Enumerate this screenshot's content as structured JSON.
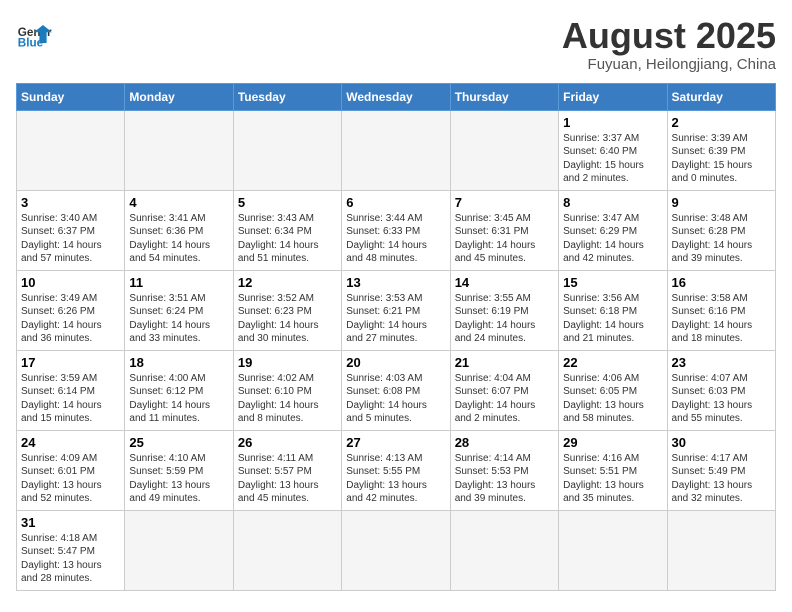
{
  "header": {
    "logo_general": "General",
    "logo_blue": "Blue",
    "title": "August 2025",
    "subtitle": "Fuyuan, Heilongjiang, China"
  },
  "days_of_week": [
    "Sunday",
    "Monday",
    "Tuesday",
    "Wednesday",
    "Thursday",
    "Friday",
    "Saturday"
  ],
  "weeks": [
    [
      {
        "day": "",
        "info": ""
      },
      {
        "day": "",
        "info": ""
      },
      {
        "day": "",
        "info": ""
      },
      {
        "day": "",
        "info": ""
      },
      {
        "day": "",
        "info": ""
      },
      {
        "day": "1",
        "info": "Sunrise: 3:37 AM\nSunset: 6:40 PM\nDaylight: 15 hours and 2 minutes."
      },
      {
        "day": "2",
        "info": "Sunrise: 3:39 AM\nSunset: 6:39 PM\nDaylight: 15 hours and 0 minutes."
      }
    ],
    [
      {
        "day": "3",
        "info": "Sunrise: 3:40 AM\nSunset: 6:37 PM\nDaylight: 14 hours and 57 minutes."
      },
      {
        "day": "4",
        "info": "Sunrise: 3:41 AM\nSunset: 6:36 PM\nDaylight: 14 hours and 54 minutes."
      },
      {
        "day": "5",
        "info": "Sunrise: 3:43 AM\nSunset: 6:34 PM\nDaylight: 14 hours and 51 minutes."
      },
      {
        "day": "6",
        "info": "Sunrise: 3:44 AM\nSunset: 6:33 PM\nDaylight: 14 hours and 48 minutes."
      },
      {
        "day": "7",
        "info": "Sunrise: 3:45 AM\nSunset: 6:31 PM\nDaylight: 14 hours and 45 minutes."
      },
      {
        "day": "8",
        "info": "Sunrise: 3:47 AM\nSunset: 6:29 PM\nDaylight: 14 hours and 42 minutes."
      },
      {
        "day": "9",
        "info": "Sunrise: 3:48 AM\nSunset: 6:28 PM\nDaylight: 14 hours and 39 minutes."
      }
    ],
    [
      {
        "day": "10",
        "info": "Sunrise: 3:49 AM\nSunset: 6:26 PM\nDaylight: 14 hours and 36 minutes."
      },
      {
        "day": "11",
        "info": "Sunrise: 3:51 AM\nSunset: 6:24 PM\nDaylight: 14 hours and 33 minutes."
      },
      {
        "day": "12",
        "info": "Sunrise: 3:52 AM\nSunset: 6:23 PM\nDaylight: 14 hours and 30 minutes."
      },
      {
        "day": "13",
        "info": "Sunrise: 3:53 AM\nSunset: 6:21 PM\nDaylight: 14 hours and 27 minutes."
      },
      {
        "day": "14",
        "info": "Sunrise: 3:55 AM\nSunset: 6:19 PM\nDaylight: 14 hours and 24 minutes."
      },
      {
        "day": "15",
        "info": "Sunrise: 3:56 AM\nSunset: 6:18 PM\nDaylight: 14 hours and 21 minutes."
      },
      {
        "day": "16",
        "info": "Sunrise: 3:58 AM\nSunset: 6:16 PM\nDaylight: 14 hours and 18 minutes."
      }
    ],
    [
      {
        "day": "17",
        "info": "Sunrise: 3:59 AM\nSunset: 6:14 PM\nDaylight: 14 hours and 15 minutes."
      },
      {
        "day": "18",
        "info": "Sunrise: 4:00 AM\nSunset: 6:12 PM\nDaylight: 14 hours and 11 minutes."
      },
      {
        "day": "19",
        "info": "Sunrise: 4:02 AM\nSunset: 6:10 PM\nDaylight: 14 hours and 8 minutes."
      },
      {
        "day": "20",
        "info": "Sunrise: 4:03 AM\nSunset: 6:08 PM\nDaylight: 14 hours and 5 minutes."
      },
      {
        "day": "21",
        "info": "Sunrise: 4:04 AM\nSunset: 6:07 PM\nDaylight: 14 hours and 2 minutes."
      },
      {
        "day": "22",
        "info": "Sunrise: 4:06 AM\nSunset: 6:05 PM\nDaylight: 13 hours and 58 minutes."
      },
      {
        "day": "23",
        "info": "Sunrise: 4:07 AM\nSunset: 6:03 PM\nDaylight: 13 hours and 55 minutes."
      }
    ],
    [
      {
        "day": "24",
        "info": "Sunrise: 4:09 AM\nSunset: 6:01 PM\nDaylight: 13 hours and 52 minutes."
      },
      {
        "day": "25",
        "info": "Sunrise: 4:10 AM\nSunset: 5:59 PM\nDaylight: 13 hours and 49 minutes."
      },
      {
        "day": "26",
        "info": "Sunrise: 4:11 AM\nSunset: 5:57 PM\nDaylight: 13 hours and 45 minutes."
      },
      {
        "day": "27",
        "info": "Sunrise: 4:13 AM\nSunset: 5:55 PM\nDaylight: 13 hours and 42 minutes."
      },
      {
        "day": "28",
        "info": "Sunrise: 4:14 AM\nSunset: 5:53 PM\nDaylight: 13 hours and 39 minutes."
      },
      {
        "day": "29",
        "info": "Sunrise: 4:16 AM\nSunset: 5:51 PM\nDaylight: 13 hours and 35 minutes."
      },
      {
        "day": "30",
        "info": "Sunrise: 4:17 AM\nSunset: 5:49 PM\nDaylight: 13 hours and 32 minutes."
      }
    ],
    [
      {
        "day": "31",
        "info": "Sunrise: 4:18 AM\nSunset: 5:47 PM\nDaylight: 13 hours and 28 minutes."
      },
      {
        "day": "",
        "info": ""
      },
      {
        "day": "",
        "info": ""
      },
      {
        "day": "",
        "info": ""
      },
      {
        "day": "",
        "info": ""
      },
      {
        "day": "",
        "info": ""
      },
      {
        "day": "",
        "info": ""
      }
    ]
  ]
}
